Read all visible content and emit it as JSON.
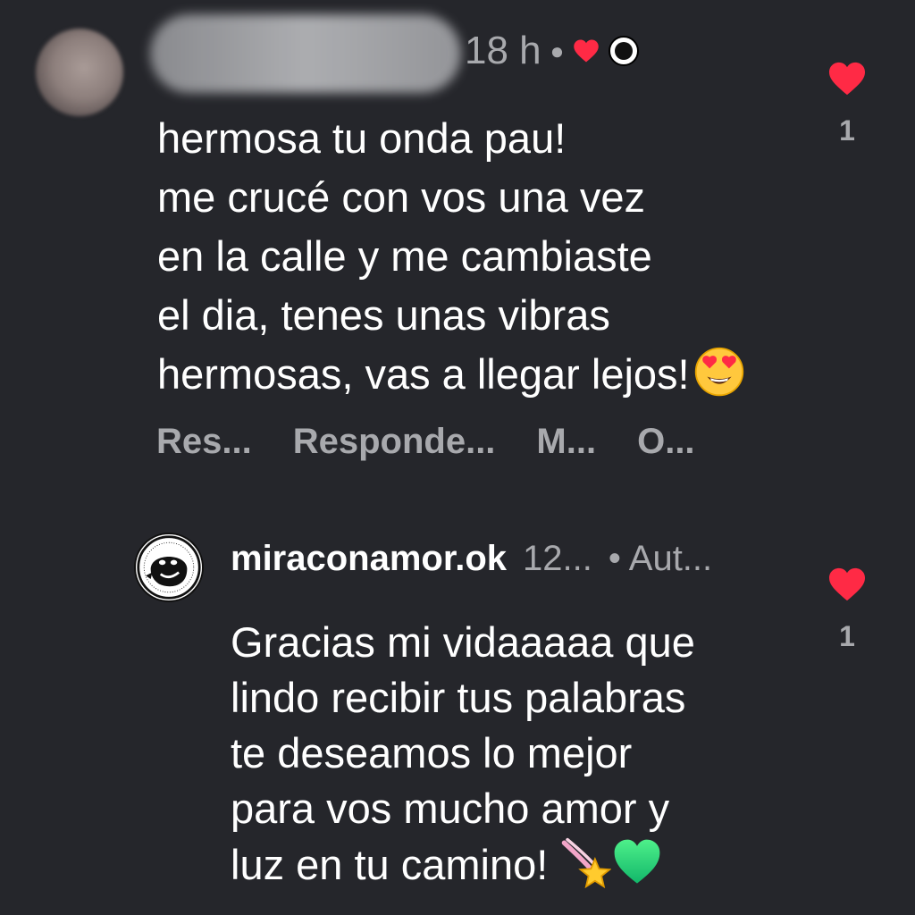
{
  "comment": {
    "time": "18 h",
    "text": "hermosa tu onda pau!\nme crucé con vos una vez\nen la calle y me cambiaste\nel dia, tenes unas vibras\nhermosas, vas a llegar lejos!",
    "actions": [
      "Res...",
      "Responde...",
      "M...",
      "O..."
    ],
    "likes": "1",
    "emoji": "heart-eyes-emoji"
  },
  "reply": {
    "username": "miraconamor.ok",
    "time": "12...",
    "author_label": "• Aut...",
    "text": "Gracias mi vidaaaaa que\nlindo recibir tus palabras\nte deseamos lo mejor\npara vos mucho amor y\nluz en tu camino!",
    "likes": "1",
    "emojis": [
      "dizzy-emoji",
      "green-heart-emoji"
    ]
  },
  "colors": {
    "background": "#25262b",
    "heart": "#ff2a45",
    "secondary_text": "#a8a9ad"
  }
}
